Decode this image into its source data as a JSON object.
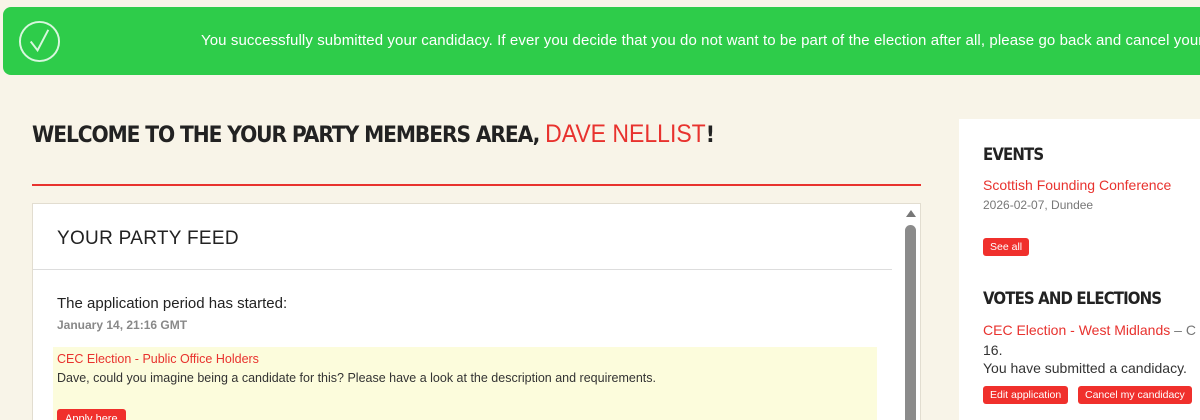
{
  "banner": {
    "icon": "checkmark-circle-icon",
    "message": "You successfully submitted your candidacy. If ever you decide that you do not want to be part of the election after all, please go back and cancel your candidacy."
  },
  "welcome": {
    "prefix": "WELCOME TO THE YOUR PARTY MEMBERS AREA, ",
    "name": "DAVE NELLIST",
    "suffix": "!"
  },
  "feed": {
    "title": "YOUR PARTY FEED",
    "post": {
      "title": "The application period has started:",
      "date": "January 14, 21:16 GMT",
      "link": "CEC Election - Public Office Holders",
      "text": "Dave, could you imagine being a candidate for this? Please have a look at the description and requirements.",
      "button": "Apply here"
    }
  },
  "sidebar": {
    "events": {
      "heading": "EVENTS",
      "item_title": "Scottish Founding Conference",
      "item_meta": "2026-02-07, Dundee",
      "see_all": "See all"
    },
    "votes": {
      "heading": "VOTES AND ELECTIONS",
      "item_title": "CEC Election - West Midlands",
      "item_sep": " – C",
      "item_cont": "16.",
      "status": "You have submitted a candidacy.",
      "edit_button": "Edit application",
      "cancel_button": "Cancel my candidacy"
    }
  },
  "colors": {
    "background": "#f8f4e8",
    "banner": "#2ecc4a",
    "accent": "#e8322e",
    "button": "#f0302c"
  }
}
